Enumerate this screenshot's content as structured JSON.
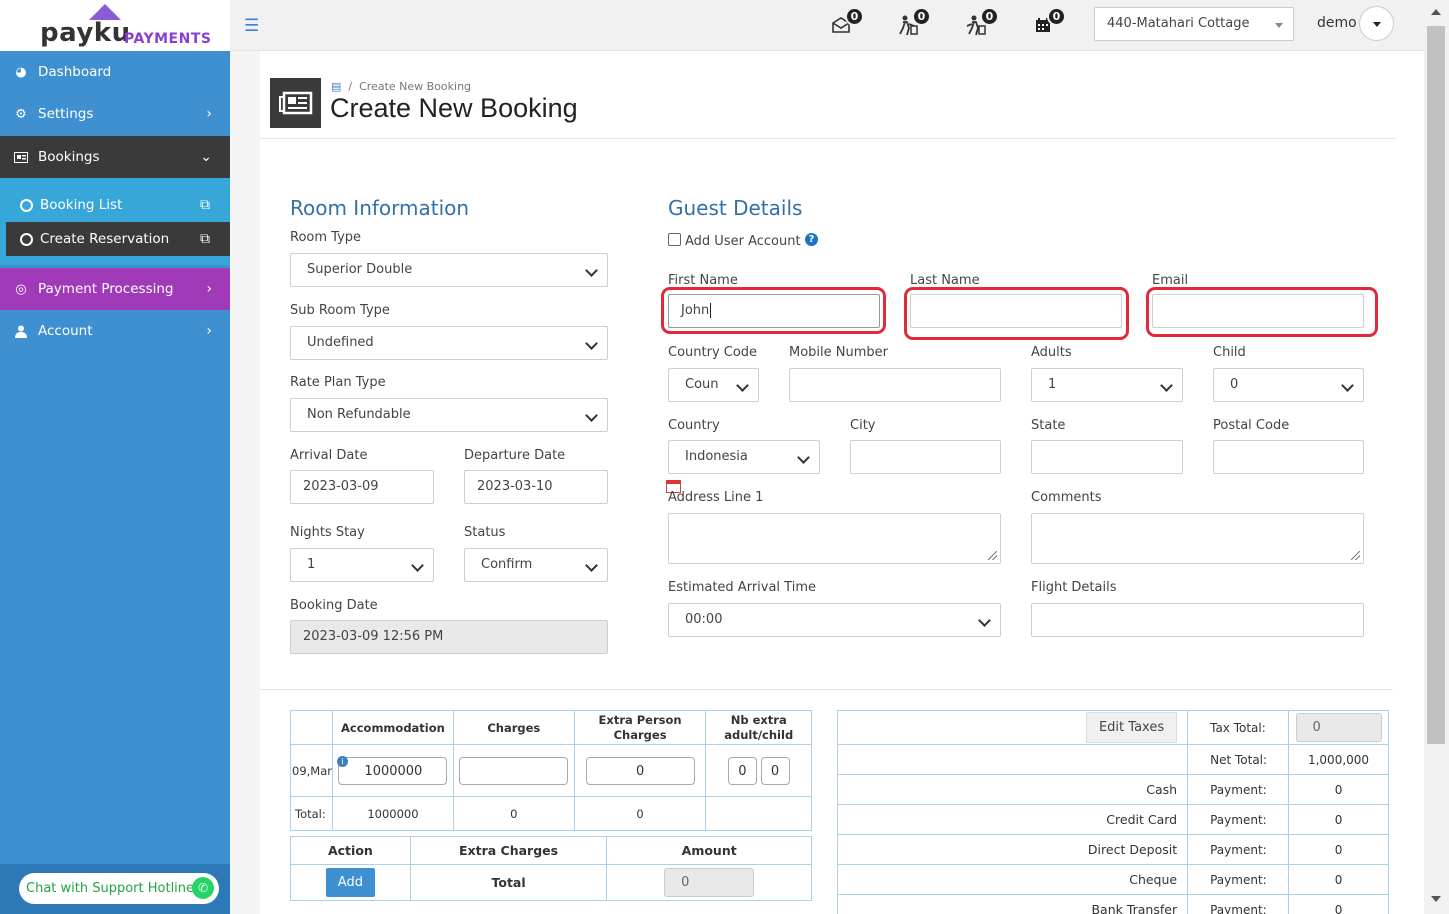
{
  "brand": {
    "name": "payku",
    "tag": "PAYMENTS"
  },
  "topbar": {
    "icons": [
      {
        "name": "inbox-icon",
        "count": "0"
      },
      {
        "name": "checkin-icon",
        "count": "0"
      },
      {
        "name": "checkout-icon",
        "count": "0"
      },
      {
        "name": "calendar-icon",
        "count": "0"
      }
    ],
    "hotel": "440-Matahari Cottage",
    "user": "demo"
  },
  "sidebar": {
    "items": [
      {
        "label": "Dashboard"
      },
      {
        "label": "Settings"
      },
      {
        "label": "Bookings"
      },
      {
        "label": "Booking List"
      },
      {
        "label": "Create Reservation"
      },
      {
        "label": "Payment Processing"
      },
      {
        "label": "Account"
      }
    ],
    "support": "Chat with Support Hotline"
  },
  "page": {
    "breadcrumb": "Create New Booking",
    "title": "Create New Booking"
  },
  "room": {
    "title": "Room Information",
    "room_type_label": "Room Type",
    "room_type": "Superior Double",
    "sub_room_label": "Sub Room Type",
    "sub_room": "Undefined",
    "rate_plan_label": "Rate Plan Type",
    "rate_plan": "Non Refundable",
    "arrival_label": "Arrival Date",
    "arrival": "2023-03-09",
    "departure_label": "Departure Date",
    "departure": "2023-03-10",
    "nights_label": "Nights Stay",
    "nights": "1",
    "status_label": "Status",
    "status": "Confirm",
    "booking_date_label": "Booking Date",
    "booking_date": "2023-03-09 12:56 PM"
  },
  "guest": {
    "title": "Guest Details",
    "add_user": "Add User Account",
    "first_name_label": "First Name",
    "first_name": "John",
    "last_name_label": "Last Name",
    "last_name": "",
    "email_label": "Email",
    "email": "",
    "country_code_label": "Country Code",
    "country_code": "Coun",
    "mobile_label": "Mobile Number",
    "mobile": "",
    "adults_label": "Adults",
    "adults": "1",
    "child_label": "Child",
    "child": "0",
    "country_label": "Country",
    "country": "Indonesia",
    "city_label": "City",
    "state_label": "State",
    "postal_label": "Postal Code",
    "address_label": "Address Line 1",
    "comments_label": "Comments",
    "eta_label": "Estimated Arrival Time",
    "eta": "00:00",
    "flight_label": "Flight Details"
  },
  "charges": {
    "headers": [
      "Accommodation",
      "Charges",
      "Extra Person Charges",
      "Nb extra adult/child"
    ],
    "row_date": "09,Mar",
    "accommodation": "1000000",
    "charges": "",
    "extra_person": "0",
    "extra_adult": "0",
    "extra_child": "0",
    "total_label": "Total:",
    "total_accommodation": "1000000",
    "total_charges": "0",
    "total_extra": "0"
  },
  "extra": {
    "headers": [
      "Action",
      "Extra Charges",
      "Amount"
    ],
    "add_label": "Add",
    "total_label": "Total",
    "amount": "0"
  },
  "totals": {
    "edit_taxes": "Edit Taxes",
    "tax_total_label": "Tax Total:",
    "tax_total": "0",
    "net_total_label": "Net Total:",
    "net_total": "1,000,000",
    "payments": [
      {
        "method": "Cash",
        "label": "Payment:",
        "value": "0"
      },
      {
        "method": "Credit Card",
        "label": "Payment:",
        "value": "0"
      },
      {
        "method": "Direct Deposit",
        "label": "Payment:",
        "value": "0"
      },
      {
        "method": "Cheque",
        "label": "Payment:",
        "value": "0"
      },
      {
        "method": "Bank Transfer",
        "label": "Payment:",
        "value": "0"
      }
    ]
  },
  "colors": {
    "sidebar": "#3f90d1",
    "active": "#3a3a3a",
    "submenu": "#37a6d9",
    "payment": "#a03ab8",
    "accent": "#3470a8",
    "highlight": "#e0293a"
  }
}
